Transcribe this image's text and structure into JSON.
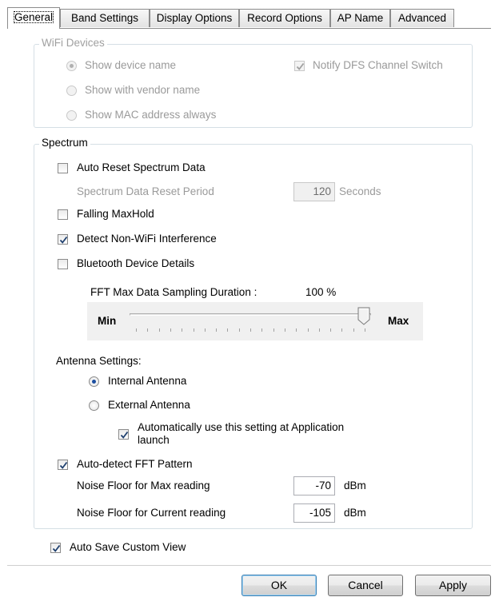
{
  "tabs": [
    {
      "label": "General",
      "active": true
    },
    {
      "label": "Band Settings"
    },
    {
      "label": "Display Options"
    },
    {
      "label": "Record Options"
    },
    {
      "label": "AP Name"
    },
    {
      "label": "Advanced"
    }
  ],
  "wifi_devices": {
    "legend": "WiFi Devices",
    "show_device_name": "Show device name",
    "show_vendor_name": "Show with vendor name",
    "show_mac": "Show MAC address always",
    "notify_dfs": "Notify DFS Channel Switch",
    "selected": "show_device_name",
    "notify_dfs_checked": true
  },
  "spectrum": {
    "legend": "Spectrum",
    "auto_reset": {
      "label": "Auto Reset Spectrum Data",
      "checked": false
    },
    "reset_period_label": "Spectrum Data Reset Period",
    "reset_period_value": "120",
    "reset_period_unit": "Seconds",
    "falling_maxhold": {
      "label": "Falling MaxHold",
      "checked": false
    },
    "detect_nonwifi": {
      "label": "Detect Non-WiFi Interference",
      "checked": true
    },
    "bluetooth_details": {
      "label": "Bluetooth Device Details",
      "checked": false
    },
    "fft_label": "FFT Max Data Sampling Duration :",
    "fft_value_text": "100 %",
    "fft_value_fraction": 1.0,
    "slider_min": "Min",
    "slider_max": "Max",
    "antenna_heading": "Antenna Settings:",
    "internal_antenna": "Internal Antenna",
    "external_antenna": "External Antenna",
    "antenna_selected": "internal",
    "auto_use_line1": "Automatically use this setting at Application",
    "auto_use_line2": "launch",
    "auto_use_checked": true,
    "auto_detect_fft": {
      "label": "Auto-detect FFT Pattern",
      "checked": true
    },
    "noise_max_label": "Noise Floor for Max reading",
    "noise_max_value": "-70",
    "noise_current_label": "Noise Floor for Current reading",
    "noise_current_value": "-105",
    "noise_unit": "dBm"
  },
  "auto_save": {
    "label": "Auto Save Custom View",
    "checked": true
  },
  "buttons": {
    "ok": "OK",
    "cancel": "Cancel",
    "apply": "Apply"
  },
  "icons": {
    "check": "checkmark-icon",
    "radio": "radio-dot-icon",
    "slider_thumb": "slider-thumb-icon"
  }
}
